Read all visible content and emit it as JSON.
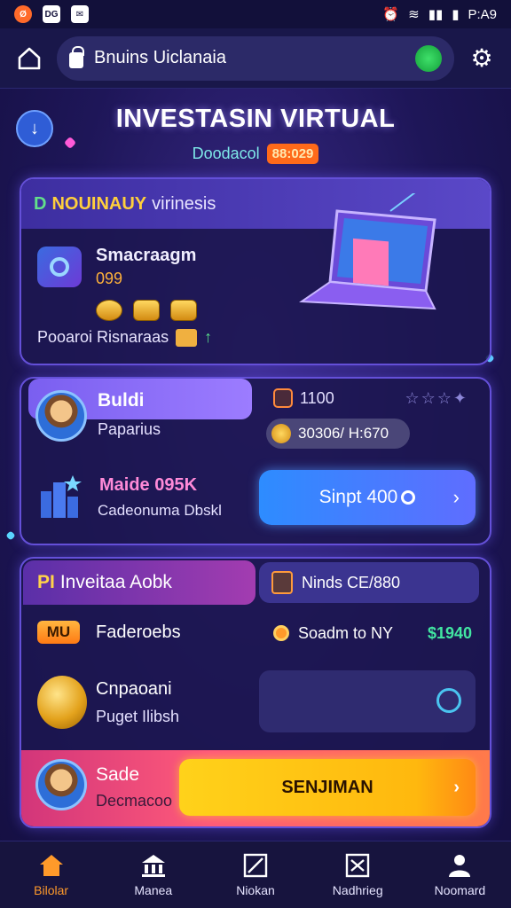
{
  "status_bar": {
    "left_icons": [
      "Ø",
      "DG",
      "✉"
    ],
    "time": "P:A9"
  },
  "address_bar": {
    "url": "Bnuins Uiclanaia"
  },
  "header": {
    "title": "INVESTASIN VIRTUAL",
    "subtitle": "Doodacol",
    "badge": "88:029"
  },
  "card1": {
    "head_a": "D",
    "head_b": "NOUINAUY",
    "head_c": "virinesis",
    "name": "Smacraagm",
    "value": "099",
    "footer": "Pooaroi Risnaraas"
  },
  "card2": {
    "name": "Buldi",
    "sub": "Paparius",
    "tab_right_label": "1100",
    "pill_value": "30306/ H:670",
    "name2": "Maide 095K",
    "sub2": "Cadeonuma Dbskl",
    "start_label": "Sinpt 400"
  },
  "card3": {
    "tab_left_a": "PI",
    "tab_left_b": "Inveitaa Aobk",
    "tab_right_label": "Ninds CE/880",
    "badge": "MU",
    "row1_label": "Faderoebs",
    "row1_right_label": "Soadm to NY",
    "row1_amount": "$1940",
    "row2_label": "Cnpaoani",
    "row2_sub": "Puget Ilibsh",
    "bottom_label": "Sade",
    "bottom_sub": "Decmacoo",
    "main_button": "SENJIMAN"
  },
  "nav": {
    "items": [
      {
        "label": "Bilolar",
        "icon": "home-icon"
      },
      {
        "label": "Manea",
        "icon": "bank-icon"
      },
      {
        "label": "Niokan",
        "icon": "chart-icon"
      },
      {
        "label": "Nadhrieg",
        "icon": "invest-icon"
      },
      {
        "label": "Noomard",
        "icon": "profile-icon"
      }
    ]
  },
  "colors": {
    "accent_orange": "#ff9a2a",
    "accent_blue": "#2d8cff",
    "accent_yellow": "#ffd21a",
    "accent_green": "#42e6a2"
  }
}
